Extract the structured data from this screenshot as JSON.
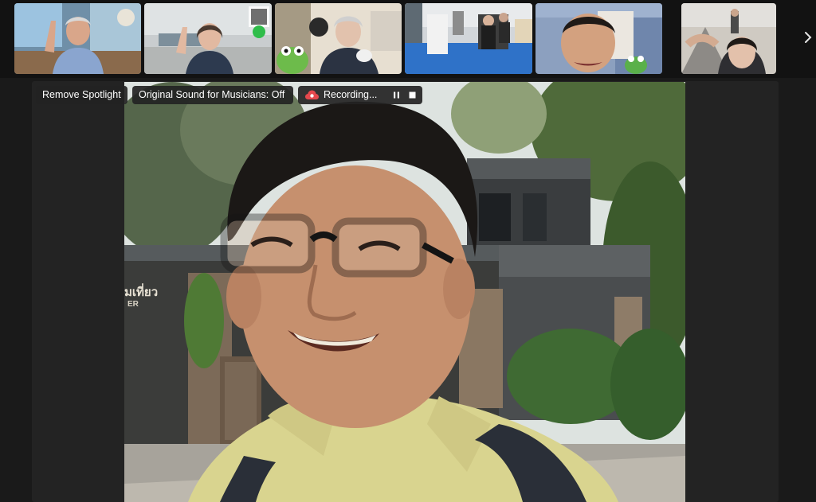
{
  "toolbar": {
    "remove_spotlight_label": "Remove Spotlight",
    "original_sound_label": "Original Sound for Musicians: Off",
    "recording_label": "Recording..."
  },
  "icons": {
    "recording": "cloud-recording-icon",
    "pause": "pause-icon",
    "stop": "stop-icon",
    "next": "chevron-right-icon"
  },
  "main_video": {
    "sign_text_1": "มเที่ยว",
    "sign_text_2": "ER"
  },
  "colors": {
    "background": "#1a1a1a",
    "strip_background": "#121212",
    "pill_background": "#232323",
    "recording_icon": "#e5484d"
  }
}
